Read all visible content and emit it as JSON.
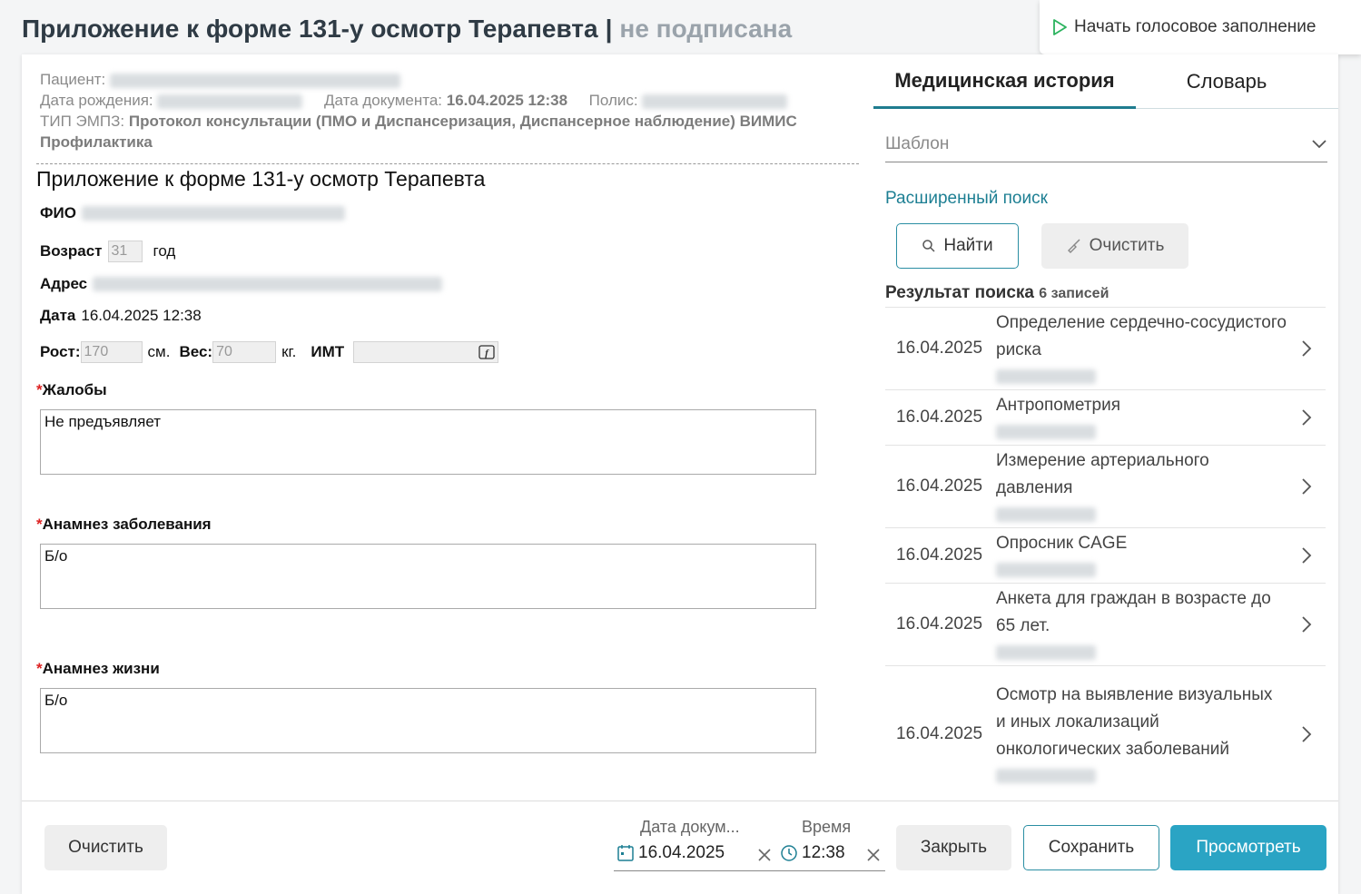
{
  "header": {
    "title": "Приложение к форме 131-у осмотр Терапевта",
    "separator": "|",
    "status": "не подписана",
    "voice_button": "Начать голосовое заполнение"
  },
  "meta": {
    "patient_label": "Пациент:",
    "birth_label": "Дата рождения:",
    "doc_date_label": "Дата документа:",
    "doc_date_value": "16.04.2025 12:38",
    "policy_label": "Полис:",
    "type_label": "ТИП ЭМПЗ:",
    "type_value": "Протокол консультации (ПМО и Диспансеризация, Диспансерное наблюдение) ВИМИС Профилактика"
  },
  "form": {
    "heading": "Приложение к форме 131-у осмотр Терапевта",
    "fio_label": "ФИО",
    "age_label": "Возраст",
    "age_value": "31",
    "age_unit": "год",
    "address_label": "Адрес",
    "date_label": "Дата",
    "date_value": "16.04.2025 12:38",
    "height_label": "Рост:",
    "height_value": "170",
    "height_unit": "см.",
    "weight_label": "Вес:",
    "weight_value": "70",
    "weight_unit": "кг.",
    "bmi_label": "ИМТ",
    "required_mark": "*",
    "complaints_label": "Жалобы",
    "complaints_value": "Не предъявляет",
    "disease_label": "Анамнез заболевания",
    "disease_value": "Б/о",
    "life_label": "Анамнез жизни",
    "life_value": "Б/о"
  },
  "right": {
    "tab_history": "Медицинская история",
    "tab_dictionary": "Словарь",
    "template_placeholder": "Шаблон",
    "advanced_search": "Расширенный поиск",
    "find_button": "Найти",
    "clear_button": "Очистить",
    "result_title": "Результат поиска",
    "result_count": "6 записей",
    "results": [
      {
        "date": "16.04.2025",
        "title": "Определение сердечно-сосудистого риска"
      },
      {
        "date": "16.04.2025",
        "title": "Антропометрия"
      },
      {
        "date": "16.04.2025",
        "title": "Измерение артериального давления"
      },
      {
        "date": "16.04.2025",
        "title": "Опросник CAGE"
      },
      {
        "date": "16.04.2025",
        "title": "Анкета для граждан в возрасте до 65 лет."
      },
      {
        "date": "16.04.2025",
        "title": "Осмотр на выявление визуальных и иных локализаций онкологических заболеваний"
      }
    ]
  },
  "footer": {
    "clear_button": "Очистить",
    "doc_date_label": "Дата докум...",
    "doc_date_value": "16.04.2025",
    "time_label": "Время",
    "time_value": "12:38",
    "close_button": "Закрыть",
    "save_button": "Сохранить",
    "view_button": "Просмотреть"
  },
  "colors": {
    "accent": "#2aa4c4",
    "link": "#1d7f93",
    "status_gray": "#9aa3ab",
    "required": "#dd2222"
  },
  "icons": [
    "play-icon",
    "chevron-down-icon",
    "search-icon",
    "broom-icon",
    "chevron-right-icon",
    "calendar-icon",
    "clock-icon",
    "close-icon",
    "function-icon"
  ]
}
